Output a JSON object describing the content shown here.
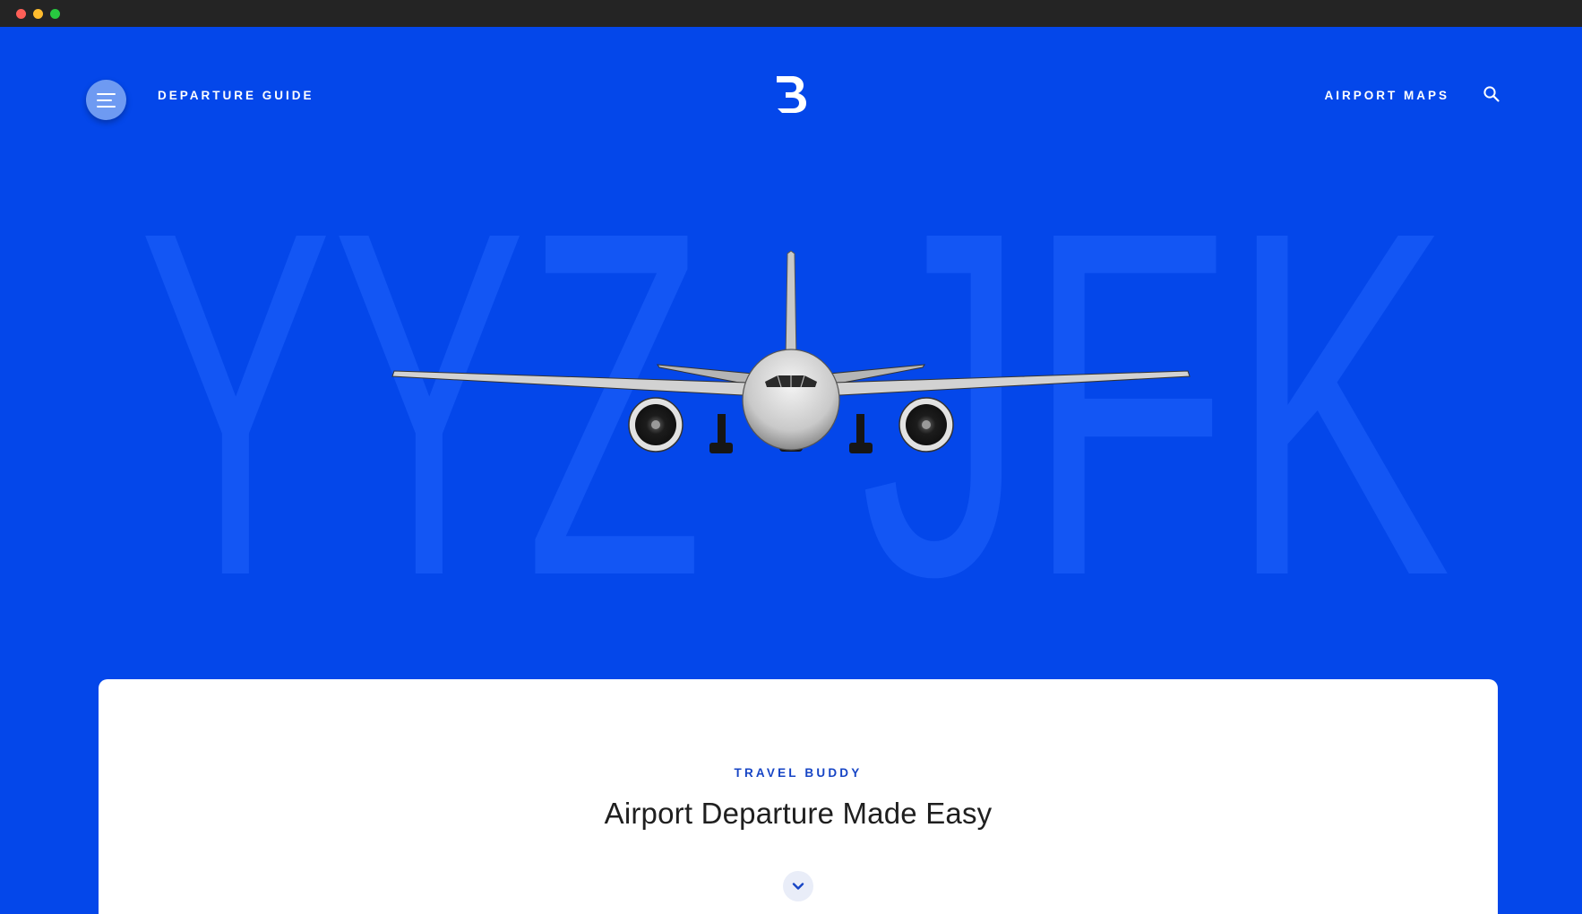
{
  "header": {
    "nav_left_label": "DEPARTURE GUIDE",
    "nav_right_label": "AIRPORT MAPS",
    "logo_letter": "B",
    "icons": {
      "menu": "hamburger-icon",
      "search": "search-icon"
    }
  },
  "hero": {
    "origin_code": "YYZ",
    "destination_code": "JFK",
    "image": "airplane-front-view"
  },
  "card": {
    "eyebrow": "TRAVEL BUDDY",
    "headline": "Airport Departure Made Easy",
    "scroll_icon": "chevron-down-icon"
  },
  "colors": {
    "background": "#0447EA",
    "code_watermark": "#1356F4",
    "accent_text": "#1745C5",
    "card": "#FFFFFF",
    "menu_button": "#6E9AF2"
  }
}
